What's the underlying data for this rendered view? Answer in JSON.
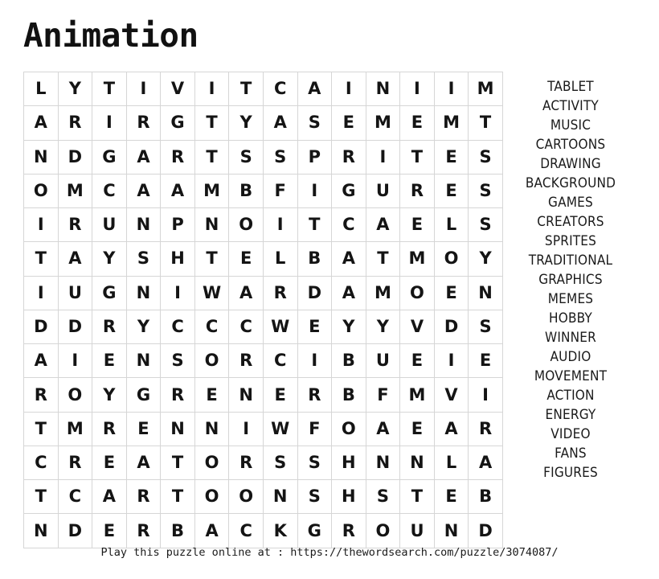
{
  "title": "Animation",
  "grid": {
    "rows": 14,
    "cols": 14,
    "letters": [
      [
        "L",
        "Y",
        "T",
        "I",
        "V",
        "I",
        "T",
        "C",
        "A",
        "I",
        "N",
        "I",
        "I",
        "M"
      ],
      [
        "A",
        "R",
        "I",
        "R",
        "G",
        "T",
        "Y",
        "A",
        "S",
        "E",
        "M",
        "E",
        "M",
        "T"
      ],
      [
        "N",
        "D",
        "G",
        "A",
        "R",
        "T",
        "S",
        "S",
        "P",
        "R",
        "I",
        "T",
        "E",
        "S"
      ],
      [
        "O",
        "M",
        "C",
        "A",
        "A",
        "M",
        "B",
        "F",
        "I",
        "G",
        "U",
        "R",
        "E",
        "S"
      ],
      [
        "I",
        "R",
        "U",
        "N",
        "P",
        "N",
        "O",
        "I",
        "T",
        "C",
        "A",
        "E",
        "L",
        "S"
      ],
      [
        "T",
        "A",
        "Y",
        "S",
        "H",
        "T",
        "E",
        "L",
        "B",
        "A",
        "T",
        "M",
        "O",
        "Y"
      ],
      [
        "I",
        "U",
        "G",
        "N",
        "I",
        "W",
        "A",
        "R",
        "D",
        "A",
        "M",
        "O",
        "E",
        "N"
      ],
      [
        "D",
        "D",
        "R",
        "Y",
        "C",
        "C",
        "C",
        "W",
        "E",
        "Y",
        "Y",
        "V",
        "D",
        "S"
      ],
      [
        "A",
        "I",
        "E",
        "N",
        "S",
        "O",
        "R",
        "C",
        "I",
        "B",
        "U",
        "E",
        "I",
        "E"
      ],
      [
        "R",
        "O",
        "Y",
        "G",
        "R",
        "E",
        "N",
        "E",
        "R",
        "B",
        "F",
        "M",
        "V",
        "I"
      ],
      [
        "T",
        "M",
        "R",
        "E",
        "N",
        "N",
        "I",
        "W",
        "F",
        "O",
        "A",
        "E",
        "A",
        "R"
      ],
      [
        "C",
        "R",
        "E",
        "A",
        "T",
        "O",
        "R",
        "S",
        "S",
        "H",
        "N",
        "N",
        "L",
        "A"
      ],
      [
        "T",
        "C",
        "A",
        "R",
        "T",
        "O",
        "O",
        "N",
        "S",
        "H",
        "S",
        "T",
        "E",
        "B"
      ],
      [
        "N",
        "D",
        "E",
        "R",
        "B",
        "A",
        "C",
        "K",
        "G",
        "R",
        "O",
        "U",
        "N",
        "D"
      ]
    ]
  },
  "word_list": {
    "words": [
      "TABLET",
      "ACTIVITY",
      "MUSIC",
      "CARTOONS",
      "DRAWING",
      "BACKGROUND",
      "GAMES",
      "CREATORS",
      "SPRITES",
      "TRADITIONAL",
      "GRAPHICS",
      "MEMES",
      "HOBBY",
      "WINNER",
      "AUDIO",
      "MOVEMENT",
      "ACTION",
      "ENERGY",
      "VIDEO",
      "FANS",
      "FIGURES"
    ]
  },
  "footer": {
    "text": "Play this puzzle online at : https://thewordsearch.com/puzzle/3074087/"
  },
  "colors": {
    "text": "#141414",
    "grid_border": "#d6d6d6",
    "background": "#ffffff"
  }
}
